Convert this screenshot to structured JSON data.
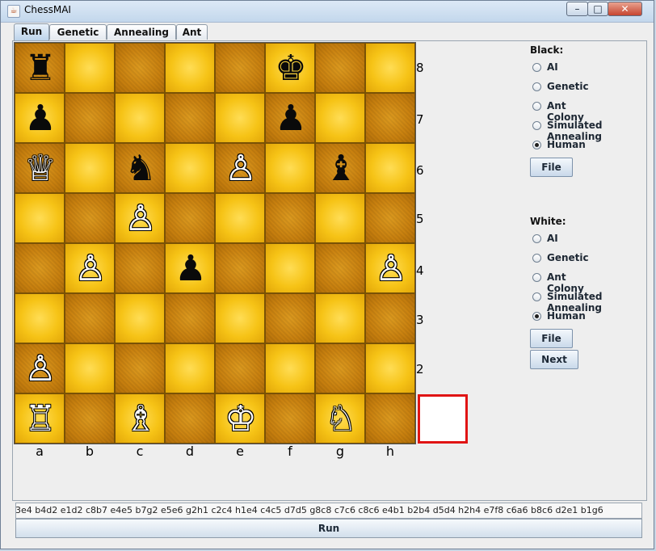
{
  "window": {
    "title": "ChessMAI",
    "app_icon": "java-cup-icon",
    "minimize_glyph": "–",
    "maximize_glyph": "□",
    "close_glyph": "✕"
  },
  "tabs": [
    {
      "label": "Run",
      "active": true
    },
    {
      "label": "Genetic",
      "active": false
    },
    {
      "label": "Annealing",
      "active": false
    },
    {
      "label": "Ant",
      "active": false
    }
  ],
  "board": {
    "ranks": [
      "8",
      "7",
      "6",
      "5",
      "4",
      "3",
      "2",
      ""
    ],
    "files": [
      "a",
      "b",
      "c",
      "d",
      "e",
      "f",
      "g",
      "h"
    ],
    "squares": [
      [
        {
          "p": "♜",
          "c": "black"
        },
        null,
        null,
        null,
        null,
        {
          "p": "♚",
          "c": "black"
        },
        null,
        null
      ],
      [
        {
          "p": "♟",
          "c": "black"
        },
        null,
        null,
        null,
        null,
        {
          "p": "♟",
          "c": "black"
        },
        null,
        null
      ],
      [
        {
          "p": "♕",
          "c": "white"
        },
        null,
        {
          "p": "♞",
          "c": "black"
        },
        null,
        {
          "p": "♙",
          "c": "white"
        },
        null,
        {
          "p": "♝",
          "c": "black"
        },
        null
      ],
      [
        null,
        null,
        {
          "p": "♙",
          "c": "white"
        },
        null,
        null,
        null,
        null,
        null
      ],
      [
        null,
        {
          "p": "♙",
          "c": "white"
        },
        null,
        {
          "p": "♟",
          "c": "black"
        },
        null,
        null,
        null,
        {
          "p": "♙",
          "c": "white"
        }
      ],
      [
        null,
        null,
        null,
        null,
        null,
        null,
        null,
        null
      ],
      [
        {
          "p": "♙",
          "c": "white"
        },
        null,
        null,
        null,
        null,
        null,
        null,
        null
      ],
      [
        {
          "p": "♖",
          "c": "white"
        },
        null,
        {
          "p": "♗",
          "c": "white"
        },
        null,
        {
          "p": "♔",
          "c": "white"
        },
        null,
        {
          "p": "♘",
          "c": "white"
        },
        null
      ]
    ]
  },
  "black_panel": {
    "label": "Black:",
    "options": [
      {
        "label": "AI",
        "checked": false
      },
      {
        "label": "Genetic",
        "checked": false
      },
      {
        "label": "Ant Colony",
        "checked": false
      },
      {
        "label": "Simulated Annealing",
        "checked": false
      },
      {
        "label": "Human",
        "checked": true
      }
    ],
    "file_button": "File"
  },
  "white_panel": {
    "label": "White:",
    "options": [
      {
        "label": "AI",
        "checked": false
      },
      {
        "label": "Genetic",
        "checked": false
      },
      {
        "label": "Ant Colony",
        "checked": false
      },
      {
        "label": "Simulated Annealing",
        "checked": false
      },
      {
        "label": "Human",
        "checked": true
      }
    ],
    "file_button": "File",
    "next_button": "Next"
  },
  "moves_log": "3e4  b4d2  e1d2  c8b7  e4e5  b7g2  e5e6  g2h1  c2c4  h1e4  c4c5  d7d5  g8c8  c7c6  c8c6  e4b1  b2b4  d5d4  h2h4  e7f8  c6a6  b8c6  d2e1  b1g6",
  "run_button": "Run"
}
